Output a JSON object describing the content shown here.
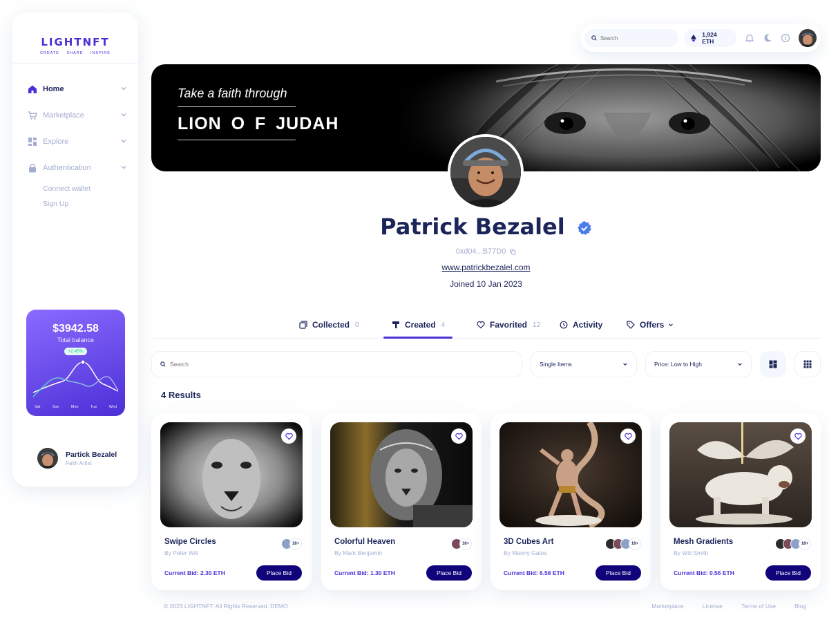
{
  "brand": {
    "name": "LIGHTNFT",
    "tagline": "CREATE   SHARE   INSPIRE"
  },
  "sidebar": {
    "items": [
      {
        "label": "Home",
        "icon": "home-icon",
        "active": true
      },
      {
        "label": "Marketplace",
        "icon": "cart-icon"
      },
      {
        "label": "Explore",
        "icon": "grid-icon"
      },
      {
        "label": "Authentication",
        "icon": "lock-icon"
      }
    ],
    "sub_items": [
      "Connect wallet",
      "Sign Up"
    ],
    "balance": {
      "amount": "$3942.58",
      "label": "Total balance",
      "change": "+2.45%",
      "days": [
        "Sat",
        "Sun",
        "Mon",
        "Tue",
        "Wed"
      ]
    },
    "user": {
      "name": "Partick Bezalel",
      "role": "Faith Artist"
    }
  },
  "topbar": {
    "search_placeholder": "Search",
    "eth_balance": "1,924 ETH"
  },
  "banner": {
    "subtitle": "Take a faith through",
    "title": "LION  O F  JUDAH"
  },
  "profile": {
    "name": "Patrick Bezalel",
    "address": "0xd04...B77D0",
    "website": "www.patrickbezalel.com",
    "joined": "Joined 10 Jan 2023"
  },
  "tabs": [
    {
      "label": "Collected",
      "count": "0",
      "icon": "collection-icon"
    },
    {
      "label": "Created",
      "count": "4",
      "icon": "brush-icon",
      "active": true
    },
    {
      "label": "Favorited",
      "count": "12",
      "icon": "heart-icon"
    },
    {
      "label": "Activity",
      "count": "",
      "icon": "clock-icon"
    },
    {
      "label": "Offers",
      "count": "",
      "icon": "tag-icon"
    }
  ],
  "filters": {
    "search_placeholder": "Search",
    "type": "Single Items",
    "sort": "Price: Low to High"
  },
  "results_label": "4 Results",
  "cards": [
    {
      "title": "Swipe Circles",
      "author": "By Peter Will",
      "bid": "Current Bid: 2.30 ETH",
      "button": "Place Bid",
      "more": "18+"
    },
    {
      "title": "Colorful Heaven",
      "author": "By Mark Benjamin",
      "bid": "Current Bid: 1.30 ETH",
      "button": "Place Bid",
      "more": "18+"
    },
    {
      "title": "3D Cubes Art",
      "author": "By Manny Gates",
      "bid": "Current Bid: 6.58 ETH",
      "button": "Place Bid",
      "more": "18+"
    },
    {
      "title": "Mesh Gradients",
      "author": "By Will Smith",
      "bid": "Current Bid: 0.56 ETH",
      "button": "Place Bid",
      "more": "18+"
    }
  ],
  "footer": {
    "copyright": "© 2023 LIGHTNFT. All Rights Reserved. DEMO",
    "links": [
      "Marketplace",
      "License",
      "Terms of Use",
      "Blog"
    ]
  },
  "colors": {
    "brand": "#4b2fd6",
    "navy": "#1b2559",
    "muted": "#a3aed0",
    "button": "#11047a",
    "verified": "#4b7bec"
  }
}
